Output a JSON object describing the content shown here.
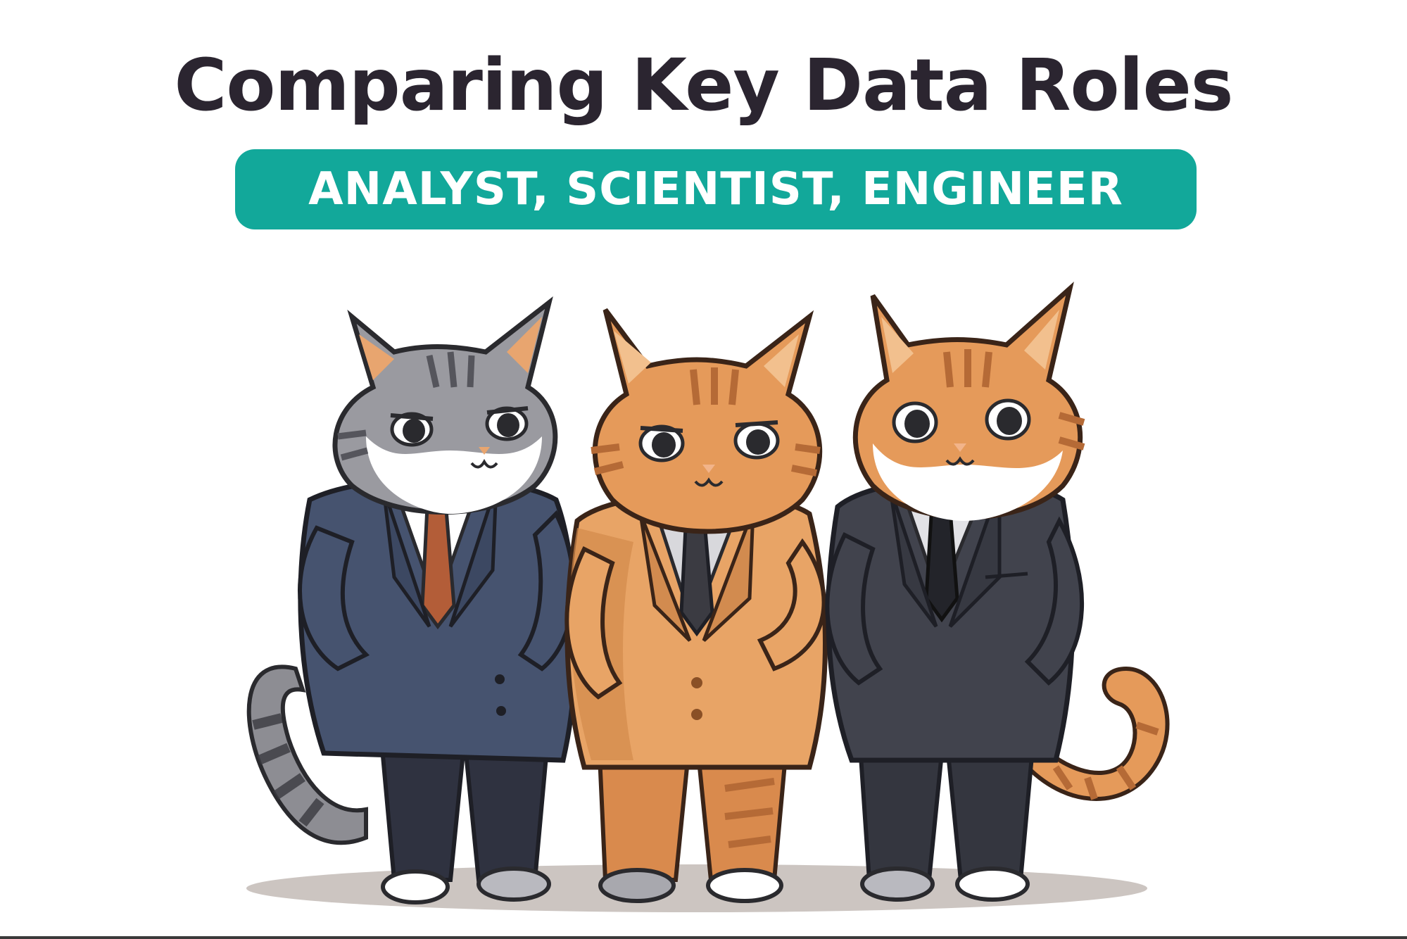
{
  "title": "Comparing Key Data Roles",
  "subtitle": "ANALYST, SCIENTIST, ENGINEER",
  "colors": {
    "title": "#2b2530",
    "pill": "#12a89a",
    "pill_text": "#ffffff",
    "suit_navy": "#46536f",
    "suit_tan": "#e8a466",
    "suit_charcoal": "#41434d",
    "fur_gray": "#9a9aa0",
    "fur_orange": "#e59a5a"
  },
  "illustration": {
    "subject": "three cats in business suits",
    "characters": [
      "gray-tabby-cat",
      "orange-tabby-cat",
      "orange-white-cat"
    ]
  }
}
